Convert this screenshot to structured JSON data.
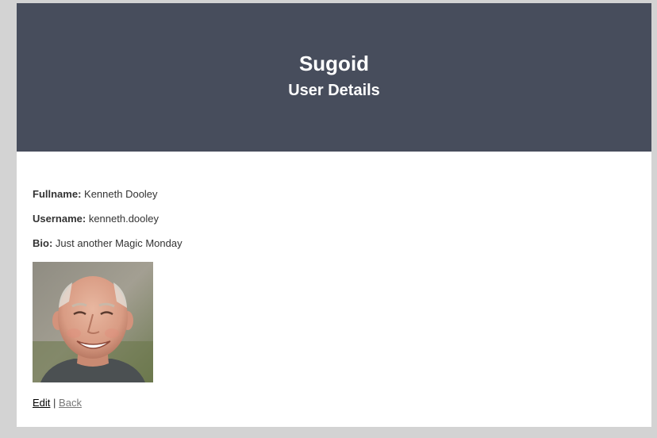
{
  "header": {
    "site_title": "Sugoid",
    "page_title": "User Details"
  },
  "user": {
    "fullname_label": "Fullname:",
    "fullname": "Kenneth Dooley",
    "username_label": "Username:",
    "username": "kenneth.dooley",
    "bio_label": "Bio:",
    "bio": "Just another Magic Monday"
  },
  "actions": {
    "edit_label": "Edit",
    "separator": "|",
    "back_label": "Back"
  },
  "colors": {
    "header_bg": "#474d5c",
    "page_bg": "#d3d3d3"
  }
}
